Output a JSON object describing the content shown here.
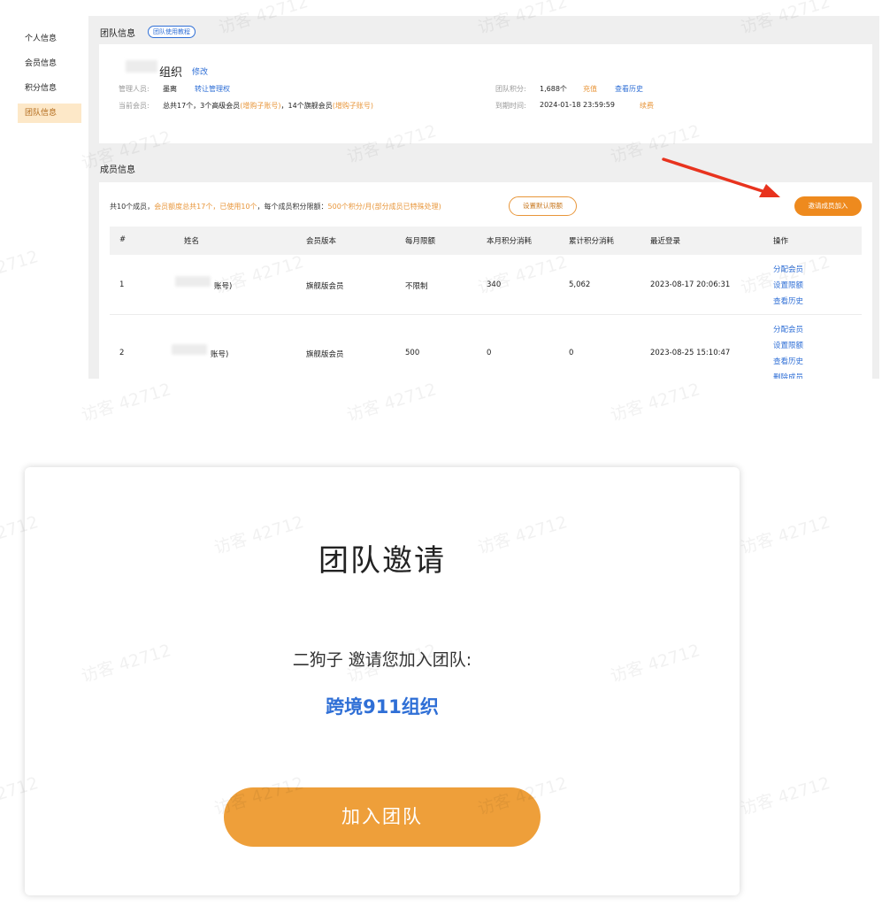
{
  "sidebar": {
    "items": [
      {
        "label": "个人信息",
        "active": false
      },
      {
        "label": "会员信息",
        "active": false
      },
      {
        "label": "积分信息",
        "active": false
      },
      {
        "label": "团队信息",
        "active": true
      }
    ]
  },
  "team_info": {
    "section_title": "团队信息",
    "tutorial_badge": "团队使用教程",
    "org_name": "组织",
    "edit_link": "修改",
    "admin_label": "管理人员:",
    "admin_value": "墨离",
    "transfer_admin_link": "转让管理权",
    "current_members_label": "当前会员:",
    "current_members_text": "总共17个，3个高级会员",
    "buy_sub_account_1": "(增购子账号)",
    "flagship_text": "，14个旗舰会员",
    "buy_sub_account_2": "(增购子账号)",
    "points_label": "团队积分:",
    "points_value": "1,688个",
    "recharge_link": "充值",
    "view_history_link": "查看历史",
    "expire_label": "到期时间:",
    "expire_value": "2024-01-18 23:59:59",
    "renew_link": "续费"
  },
  "member_info": {
    "section_title": "成员信息",
    "summary_prefix": "共10个成员，",
    "summary_quota": "会员额度总共17个，已使用10个",
    "summary_mid": "，每个成员积分限额：",
    "summary_limit": "500个积分/月(部分成员已特殊处理)",
    "default_limit_button": "设置默认限额",
    "invite_button": "邀请成员加入",
    "columns": [
      "#",
      "姓名",
      "会员版本",
      "每月限额",
      "本月积分消耗",
      "累计积分消耗",
      "最近登录",
      "操作"
    ],
    "rows": [
      {
        "index": "1",
        "name": "账号)",
        "version": "旗舰版会员",
        "monthly_limit": "不限制",
        "month_used": "340",
        "total_used": "5,062",
        "last_login": "2023-08-17 20:06:31",
        "actions": [
          "分配会员",
          "设置限额",
          "查看历史"
        ]
      },
      {
        "index": "2",
        "name": "账号)",
        "version": "旗舰版会员",
        "monthly_limit": "500",
        "month_used": "0",
        "total_used": "0",
        "last_login": "2023-08-25 15:10:47",
        "actions": [
          "分配会员",
          "设置限额",
          "查看历史",
          "删除成员"
        ]
      }
    ]
  },
  "invite_card": {
    "title": "团队邀请",
    "message": "二狗子 邀请您加入团队:",
    "org_name": "跨境911组织",
    "join_button": "加入团队"
  },
  "watermark": "访客 42712",
  "colors": {
    "accent_orange": "#ee8a1e",
    "link_blue": "#2f6fd6",
    "active_bg": "#fde8c8",
    "arrow_red": "#e8331e"
  }
}
